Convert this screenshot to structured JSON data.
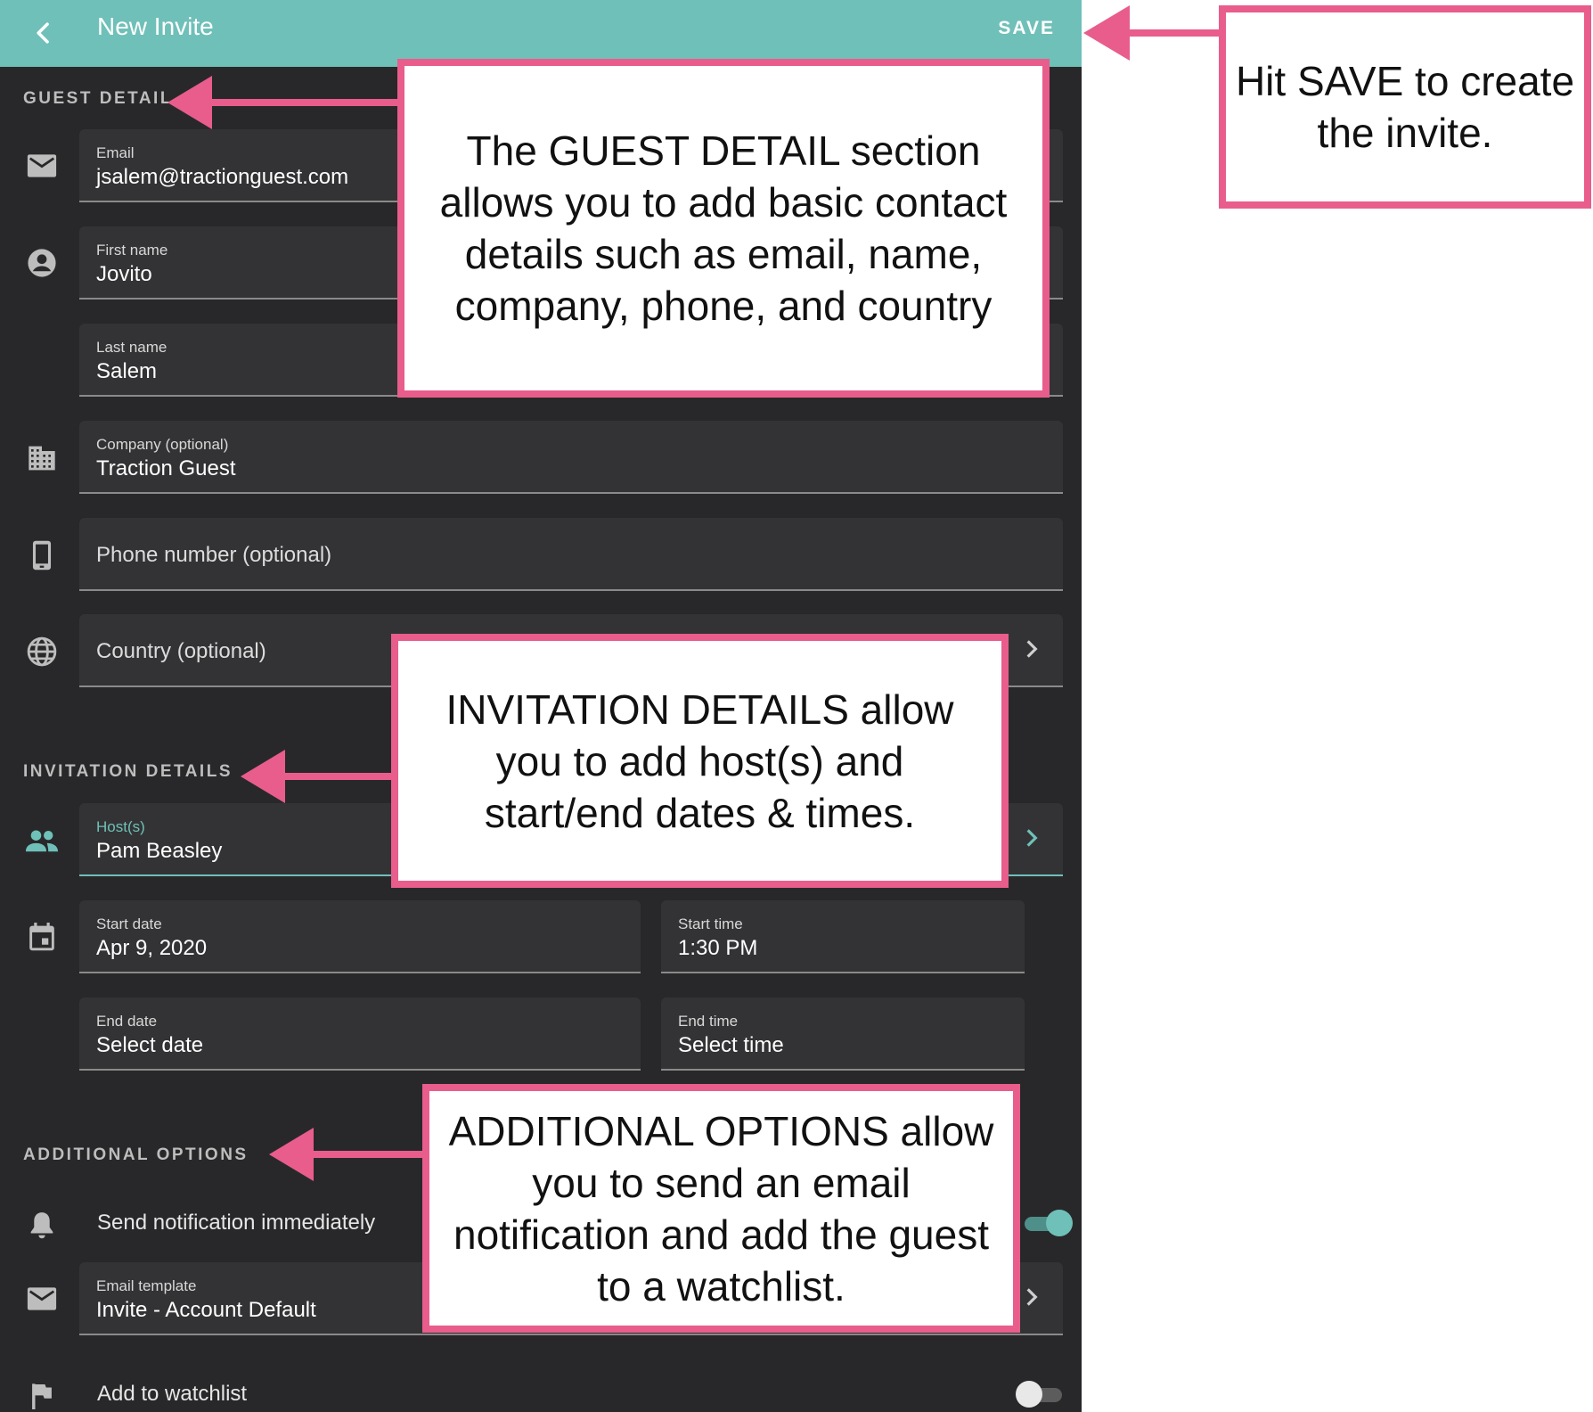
{
  "header": {
    "title": "New Invite",
    "save_label": "SAVE"
  },
  "guest_detail": {
    "section_title": "GUEST DETAIL",
    "email": {
      "label": "Email",
      "value": "jsalem@tractionguest.com"
    },
    "first_name": {
      "label": "First name",
      "value": "Jovito"
    },
    "last_name": {
      "label": "Last name",
      "value": "Salem"
    },
    "company": {
      "label": "Company (optional)",
      "value": "Traction Guest"
    },
    "phone": {
      "placeholder": "Phone number (optional)"
    },
    "country": {
      "placeholder": "Country (optional)"
    }
  },
  "invitation_details": {
    "section_title": "INVITATION DETAILS",
    "hosts": {
      "label": "Host(s)",
      "value": "Pam Beasley"
    },
    "start_date": {
      "label": "Start date",
      "value": "Apr 9, 2020"
    },
    "start_time": {
      "label": "Start time",
      "value": "1:30 PM"
    },
    "end_date": {
      "label": "End date",
      "value": "Select date"
    },
    "end_time": {
      "label": "End time",
      "value": "Select time"
    }
  },
  "additional_options": {
    "section_title": "ADDITIONAL OPTIONS",
    "send_notification": {
      "label": "Send notification immediately",
      "enabled": true
    },
    "email_template": {
      "label": "Email template",
      "value": "Invite - Account Default"
    },
    "watchlist": {
      "label": "Add to watchlist",
      "enabled": false
    }
  },
  "callouts": {
    "save": "Hit SAVE to create the invite.",
    "guest_detail": "The GUEST DETAIL section allows you to add basic contact details such as email, name, company, phone, and country",
    "invitation_details": "INVITATION DETAILS allow you to add host(s) and start/end dates & times.",
    "additional_options": "ADDITIONAL OPTIONS allow you to send an email notification and add the guest to a watchlist."
  },
  "colors": {
    "accent": "#6fc0b8",
    "callout_border": "#e85d8c",
    "background": "#28282a"
  },
  "icons": [
    "back-arrow-icon",
    "mail-icon",
    "account-circle-icon",
    "building-icon",
    "smartphone-icon",
    "globe-icon",
    "people-icon",
    "calendar-icon",
    "bell-icon",
    "flag-icon",
    "chevron-right-icon"
  ]
}
